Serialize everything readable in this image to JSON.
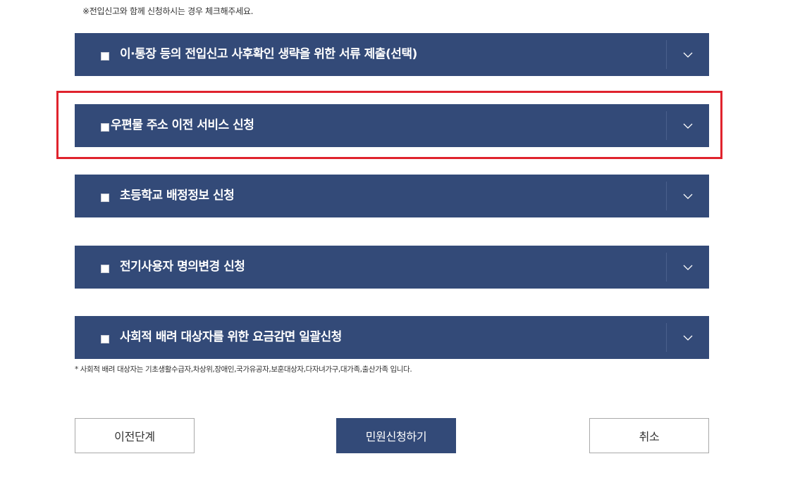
{
  "top_note": "※전입신고와 함께 신청하시는 경우 체크해주세요.",
  "services": [
    {
      "label": "이·통장 등의 전입신고 사후확인 생략을 위한 서류 제출(선택)",
      "checked": false
    },
    {
      "label": "우편물 주소 이전 서비스 신청",
      "checked": false
    },
    {
      "label": "초등학교 배정정보 신청",
      "checked": false
    },
    {
      "label": "전기사용자 명의변경 신청",
      "checked": false
    },
    {
      "label": "사회적 배려 대상자를 위한 요금감면 일괄신청",
      "checked": false
    }
  ],
  "icons": {
    "toggle": "chevron-down-icon",
    "checkbox": "checkbox-icon"
  },
  "footnote": "* 사회적 배려 대상자는 기초생활수급자,차상위,장애인,국가유공자,보훈대상자,다자녀가구,대가족,출산가족 입니다.",
  "buttons": {
    "prev": "이전단계",
    "submit": "민원신청하기",
    "cancel": "취소"
  },
  "colors": {
    "accordion_bg": "#334a78",
    "highlight": "#e0232d"
  }
}
